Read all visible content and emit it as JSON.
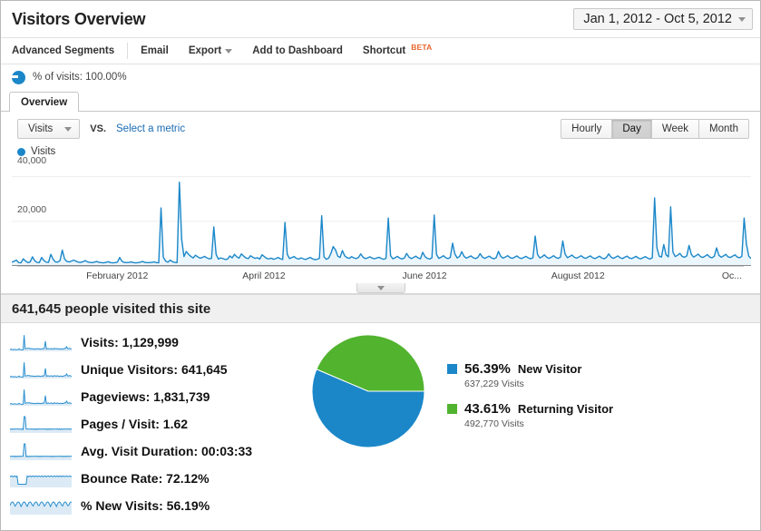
{
  "header": {
    "title": "Visitors Overview",
    "date_range": "Jan 1, 2012 - Oct 5, 2012",
    "date_caret_icon": "chevron-down-icon"
  },
  "toolbar": {
    "advanced_segments": "Advanced Segments",
    "email": "Email",
    "export": "Export",
    "export_caret_icon": "chevron-down-icon",
    "add_to_dashboard": "Add to Dashboard",
    "shortcut": "Shortcut",
    "shortcut_badge": "BETA",
    "badge_color": "#e8642c"
  },
  "visits_filter": {
    "icon": "pie-chart-icon",
    "label": "% of visits: 100.00%"
  },
  "tabs": [
    {
      "label": "Overview",
      "active": true
    }
  ],
  "metric_selector": {
    "primary_metric": "Visits",
    "primary_caret_icon": "chevron-down-icon",
    "vs_label": "VS.",
    "secondary_metric_link": "Select a metric",
    "link_color": "#1a6cb5"
  },
  "granularity": {
    "options": [
      "Hourly",
      "Day",
      "Week",
      "Month"
    ],
    "selected": "Day"
  },
  "chart_data": {
    "type": "line",
    "title": "Visits",
    "legend_label": "Visits",
    "legend_position": "top-left",
    "series_color": "#1b87c9",
    "fill_color": "#e8f4fb",
    "xlabel": "",
    "ylabel": "",
    "ylim": [
      0,
      48000
    ],
    "yticks": [
      20000,
      40000
    ],
    "ytick_labels": [
      "20,000",
      "40,000"
    ],
    "grid": true,
    "xtick_labels": [
      "February 2012",
      "April 2012",
      "June 2012",
      "August 2012",
      "Oc..."
    ],
    "xtick_positions": [
      0.13,
      0.345,
      0.565,
      0.785,
      0.975
    ],
    "values": [
      1700,
      2100,
      2600,
      1500,
      1400,
      3200,
      2200,
      1500,
      1800,
      4100,
      2300,
      1600,
      1500,
      3800,
      2400,
      1700,
      1600,
      5200,
      3000,
      1800,
      1700,
      2400,
      7100,
      3100,
      2000,
      1800,
      2200,
      2600,
      2100,
      1700,
      1600,
      1900,
      2400,
      1800,
      1600,
      1500,
      1700,
      2000,
      1600,
      1500,
      1400,
      1600,
      1900,
      1500,
      1400,
      1500,
      1700,
      3800,
      2100,
      1600,
      1500,
      1600,
      1800,
      1500,
      1400,
      1500,
      1700,
      2000,
      1600,
      1500,
      1500,
      1600,
      1800,
      1500,
      1400,
      26000,
      4000,
      2200,
      1700,
      2600,
      1900,
      1600,
      1500,
      37500,
      12000,
      4200,
      6500,
      5200,
      4300,
      3600,
      4800,
      4100,
      3500,
      3800,
      4300,
      3600,
      3200,
      3400,
      17500,
      5200,
      3100,
      3600,
      3300,
      2900,
      3100,
      4500,
      3600,
      5200,
      4100,
      3500,
      5400,
      4400,
      3600,
      3300,
      4600,
      3900,
      3400,
      3700,
      3100,
      5000,
      4200,
      3400,
      3200,
      3500,
      3000,
      3300,
      3800,
      3200,
      2900,
      19500,
      5200,
      3300,
      3800,
      4200,
      3400,
      3100,
      3600,
      3200,
      2900,
      3400,
      3800,
      3200,
      2800,
      3000,
      3400,
      22500,
      4100,
      3000,
      3500,
      5600,
      8700,
      7200,
      4400,
      3800,
      6900,
      4600,
      3700,
      3400,
      4200,
      3600,
      3300,
      3800,
      5400,
      3900,
      3300,
      3600,
      4100,
      3500,
      3200,
      3600,
      3900,
      3300,
      3000,
      3400,
      21500,
      4600,
      3200,
      3700,
      4300,
      3500,
      3100,
      3600,
      5600,
      4000,
      3300,
      3800,
      4400,
      3600,
      3200,
      6100,
      4200,
      3400,
      3100,
      3600,
      22800,
      5200,
      3400,
      3900,
      4600,
      3700,
      3300,
      3800,
      10200,
      5400,
      3600,
      4200,
      6400,
      4300,
      3500,
      4000,
      4500,
      3700,
      3300,
      3800,
      5500,
      4000,
      3400,
      3900,
      4400,
      3600,
      3200,
      3700,
      6500,
      4300,
      3500,
      4000,
      4600,
      3800,
      3400,
      3900,
      4500,
      3700,
      3300,
      3800,
      4300,
      3600,
      3200,
      3700,
      13400,
      5200,
      3600,
      4100,
      5000,
      3900,
      3400,
      3900,
      4600,
      3800,
      3400,
      4000,
      11200,
      5400,
      3700,
      4200,
      4900,
      3900,
      3500,
      4000,
      4600,
      3800,
      3400,
      4000,
      4500,
      3700,
      3300,
      3800,
      4400,
      3600,
      3200,
      3800,
      5400,
      4000,
      3400,
      3900,
      4500,
      3700,
      3300,
      3900,
      4400,
      3600,
      3300,
      3800,
      4300,
      3500,
      3200,
      3700,
      4200,
      3500,
      3100,
      3700,
      30500,
      8200,
      4400,
      4000,
      9600,
      5000,
      4100,
      26500,
      6200,
      4200,
      4800,
      5600,
      4300,
      3900,
      4500,
      9200,
      5200,
      4000,
      4600,
      5300,
      4200,
      3800,
      4400,
      5100,
      4000,
      3700,
      4300,
      8100,
      4800,
      3900,
      4500,
      5200,
      4100,
      3800,
      4400,
      5000,
      4000,
      3700,
      4300,
      21500,
      9800,
      4400,
      3300
    ]
  },
  "summary": {
    "text": "641,645 people visited this site"
  },
  "metrics": [
    {
      "label": "Visits:",
      "value": "1,129,999",
      "sparkline": "visits-sparkline"
    },
    {
      "label": "Unique Visitors:",
      "value": "641,645",
      "sparkline": "unique-visitors-sparkline"
    },
    {
      "label": "Pageviews:",
      "value": "1,831,739",
      "sparkline": "pageviews-sparkline"
    },
    {
      "label": "Pages / Visit:",
      "value": "1.62",
      "sparkline": "pages-per-visit-sparkline"
    },
    {
      "label": "Avg. Visit Duration:",
      "value": "00:03:33",
      "sparkline": "avg-visit-duration-sparkline"
    },
    {
      "label": "Bounce Rate:",
      "value": "72.12%",
      "sparkline": "bounce-rate-sparkline"
    },
    {
      "label": "% New Visits:",
      "value": "56.19%",
      "sparkline": "new-visits-sparkline"
    }
  ],
  "visitor_pie": {
    "type": "pie",
    "title": "",
    "slices": [
      {
        "label": "New Visitor",
        "percent": "56.39%",
        "value": 56.39,
        "visits": "637,229 Visits",
        "color": "#1b87c9"
      },
      {
        "label": "Returning Visitor",
        "percent": "43.61%",
        "value": 43.61,
        "visits": "492,770 Visits",
        "color": "#51b32e"
      }
    ]
  },
  "collapse_control": {
    "icon": "chevron-down-icon"
  }
}
